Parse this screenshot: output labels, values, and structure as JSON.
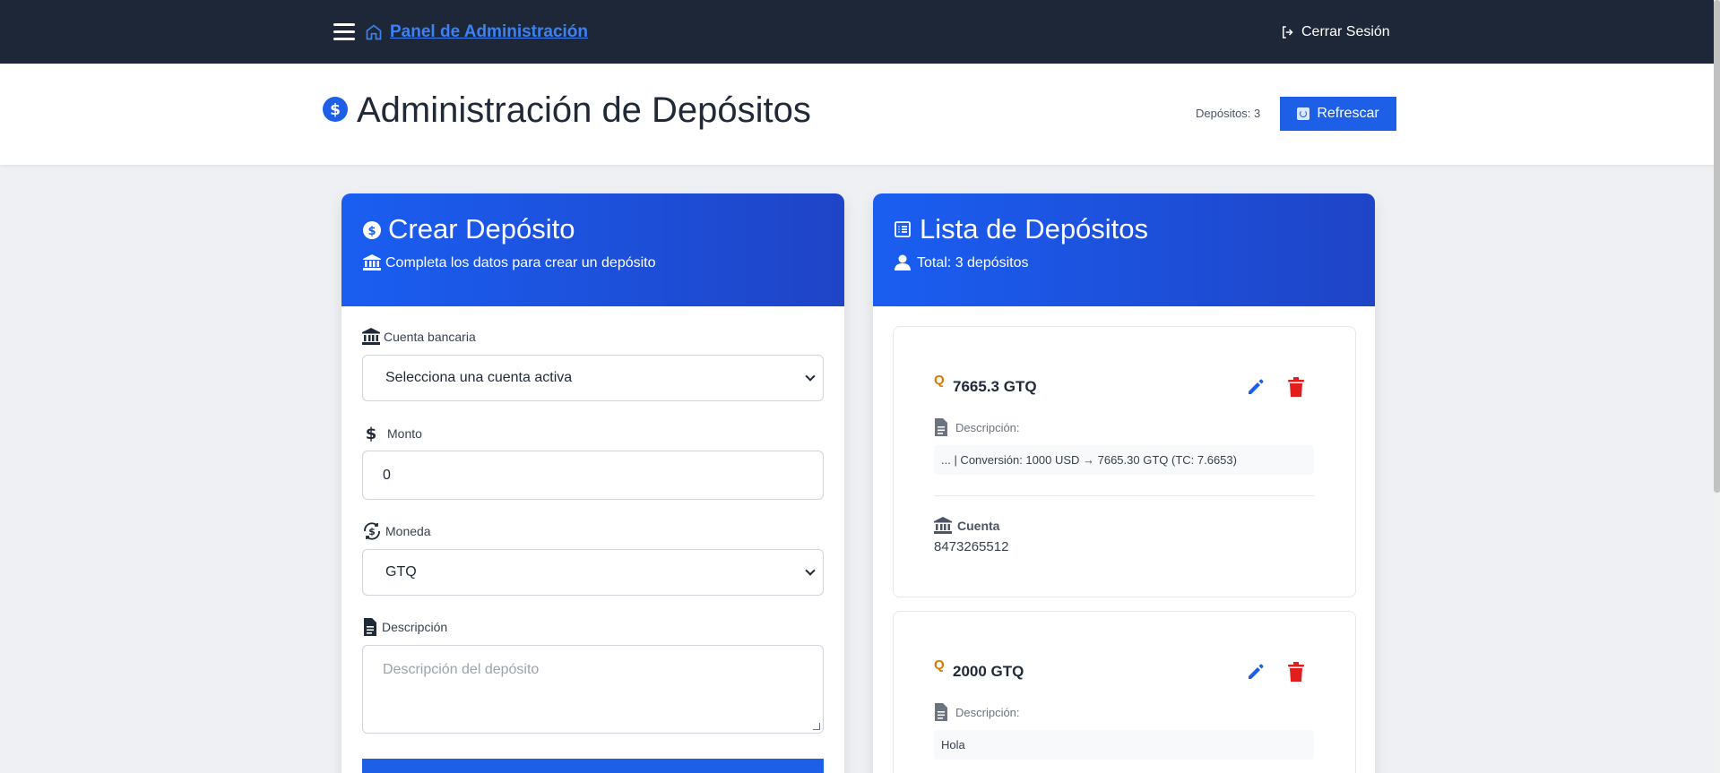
{
  "nav": {
    "brand": "Panel de Administración",
    "logout": "Cerrar Sesión"
  },
  "header": {
    "title": "Administración de Depósitos",
    "count": "Depósitos: 3",
    "refresh": "Refrescar"
  },
  "create_card": {
    "title": "Crear Depósito",
    "subtitle": "Completa los datos para crear un depósito",
    "fields": {
      "account_label": "Cuenta bancaria",
      "account_value": "Selecciona una cuenta activa",
      "amount_label": "Monto",
      "amount_value": "0",
      "currency_label": "Moneda",
      "currency_value": "GTQ",
      "description_label": "Descripción",
      "description_placeholder": "Descripción del depósito"
    }
  },
  "list_card": {
    "title": "Lista de Depósitos",
    "subtitle": "Total: 3 depósitos",
    "items": [
      {
        "badge": "Q",
        "amount": "7665.3 GTQ",
        "desc_label": "Descripción:",
        "description": "... | Conversión: 1000 USD → 7665.30 GTQ (TC: 7.6653)",
        "account_label": "Cuenta",
        "account": "8473265512"
      },
      {
        "badge": "Q",
        "amount": "2000 GTQ",
        "desc_label": "Descripción:",
        "description": "Hola"
      }
    ]
  },
  "colors": {
    "nav_bg": "#1e2737",
    "primary": "#1d5fe6",
    "danger": "#e11d1d",
    "badge": "#d97706"
  }
}
